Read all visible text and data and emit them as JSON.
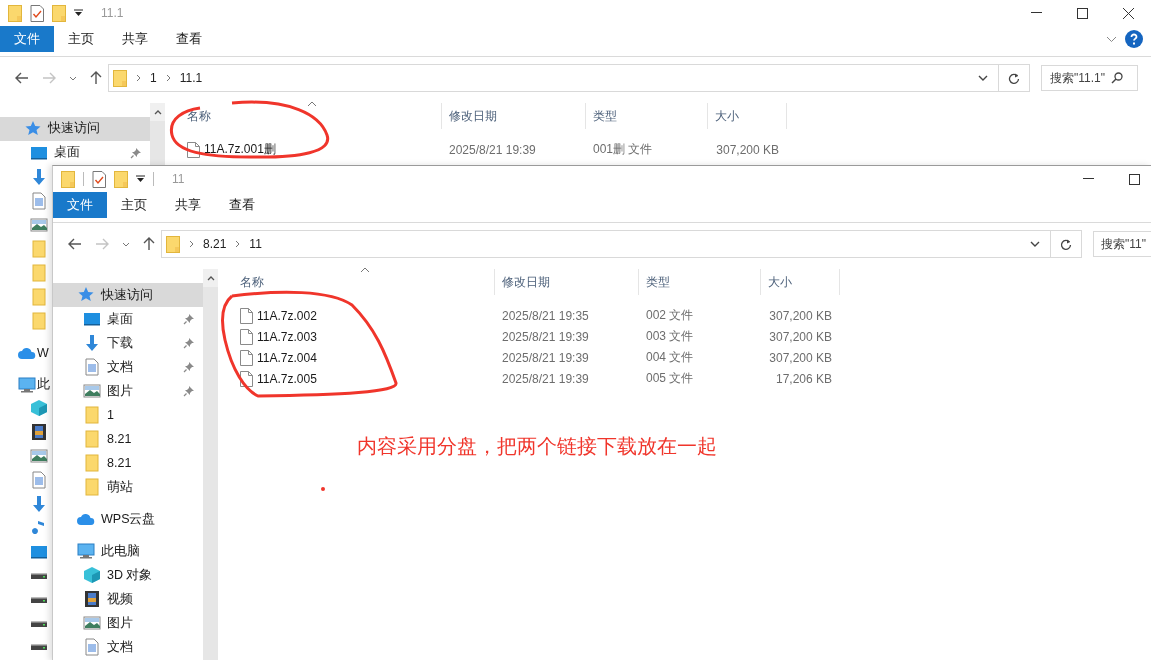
{
  "windows": [
    {
      "title": "11.1",
      "ribbon_tabs": [
        {
          "label": "文件",
          "selected": true
        },
        {
          "label": "主页",
          "selected": false
        },
        {
          "label": "共享",
          "selected": false
        },
        {
          "label": "查看",
          "selected": false
        }
      ],
      "path": [
        "1",
        "11.1"
      ],
      "search": {
        "placeholder": "搜索\"11.1\""
      },
      "nav": [
        {
          "label": "快速访问",
          "kind": "star",
          "selected": true,
          "children": [
            {
              "label": "桌面",
              "kind": "desktop",
              "selected": false,
              "pinned": true
            },
            {
              "kind": "download",
              "selected": false
            },
            {
              "kind": "document",
              "selected": false
            },
            {
              "kind": "picture",
              "selected": false
            },
            {
              "kind": "folder",
              "selected": false
            },
            {
              "kind": "folder",
              "selected": false
            },
            {
              "kind": "folder",
              "selected": false
            },
            {
              "kind": "folder",
              "selected": false
            }
          ]
        },
        {
          "label": "W",
          "kind": "cloud",
          "selected": false
        },
        {
          "label": "此",
          "kind": "pc",
          "selected": false,
          "children": [
            {
              "kind": "cube",
              "selected": false
            },
            {
              "kind": "video",
              "selected": false
            },
            {
              "kind": "picture",
              "selected": false
            },
            {
              "kind": "document",
              "selected": false
            },
            {
              "kind": "download",
              "selected": false
            },
            {
              "kind": "music",
              "selected": false
            },
            {
              "kind": "desktop",
              "selected": false
            },
            {
              "kind": "drive",
              "selected": false
            },
            {
              "kind": "drive",
              "selected": false
            },
            {
              "kind": "drive",
              "selected": false
            },
            {
              "kind": "drive",
              "selected": false
            }
          ]
        }
      ],
      "columns": [
        "名称",
        "修改日期",
        "类型",
        "大小"
      ],
      "files": [
        {
          "name": "11A.7z.001删",
          "date": "2025/8/21 19:39",
          "type": "001删 文件",
          "size": "307,200 KB"
        }
      ]
    },
    {
      "title": "11",
      "ribbon_tabs": [
        {
          "label": "文件",
          "selected": true
        },
        {
          "label": "主页",
          "selected": false
        },
        {
          "label": "共享",
          "selected": false
        },
        {
          "label": "查看",
          "selected": false
        }
      ],
      "path": [
        "8.21",
        "11"
      ],
      "search": {
        "placeholder": "搜索\"11\""
      },
      "nav": [
        {
          "label": "快速访问",
          "kind": "star",
          "selected": true,
          "children": [
            {
              "label": "桌面",
              "kind": "desktop",
              "selected": false,
              "pinned": true
            },
            {
              "label": "下载",
              "kind": "download",
              "selected": false,
              "pinned": true
            },
            {
              "label": "文档",
              "kind": "document",
              "selected": false,
              "pinned": true
            },
            {
              "label": "图片",
              "kind": "picture",
              "selected": false,
              "pinned": true
            },
            {
              "label": "1",
              "kind": "folder",
              "selected": false
            },
            {
              "label": "8.21",
              "kind": "folder",
              "selected": false
            },
            {
              "label": "8.21",
              "kind": "folder",
              "selected": false
            },
            {
              "label": "萌站",
              "kind": "folder",
              "selected": false
            }
          ]
        },
        {
          "label": "WPS云盘",
          "kind": "cloud",
          "selected": false
        },
        {
          "label": "此电脑",
          "kind": "pc",
          "selected": false,
          "children": [
            {
              "label": "3D 对象",
              "kind": "cube",
              "selected": false
            },
            {
              "label": "视频",
              "kind": "video",
              "selected": false
            },
            {
              "label": "图片",
              "kind": "picture",
              "selected": false
            },
            {
              "label": "文档",
              "kind": "document",
              "selected": false
            }
          ]
        }
      ],
      "columns": [
        "名称",
        "修改日期",
        "类型",
        "大小"
      ],
      "files": [
        {
          "name": "11A.7z.002",
          "date": "2025/8/21 19:35",
          "type": "002 文件",
          "size": "307,200 KB"
        },
        {
          "name": "11A.7z.003",
          "date": "2025/8/21 19:39",
          "type": "003 文件",
          "size": "307,200 KB"
        },
        {
          "name": "11A.7z.004",
          "date": "2025/8/21 19:39",
          "type": "004 文件",
          "size": "307,200 KB"
        },
        {
          "name": "11A.7z.005",
          "date": "2025/8/21 19:39",
          "type": "005 文件",
          "size": "17,206 KB"
        }
      ]
    }
  ],
  "annotation": {
    "note": "内容采用分盘，把两个链接下载放在一起"
  }
}
